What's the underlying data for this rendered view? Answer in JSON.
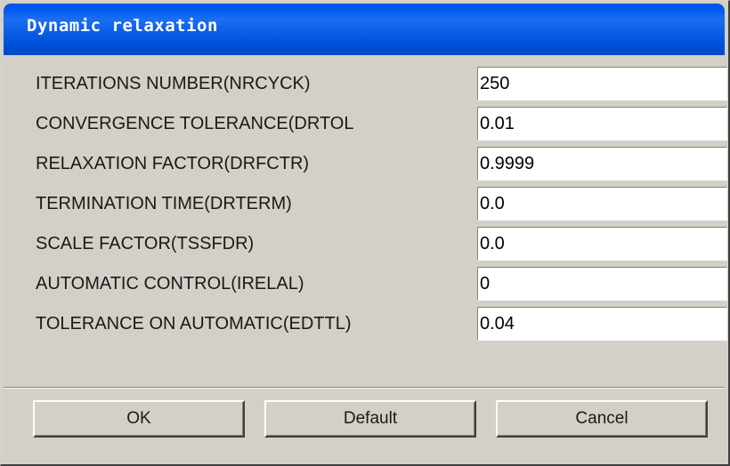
{
  "window": {
    "title": "Dynamic relaxation"
  },
  "fields": [
    {
      "label": "ITERATIONS NUMBER(NRCYCK)",
      "value": "250"
    },
    {
      "label": "CONVERGENCE TOLERANCE(DRTOL",
      "value": "0.01"
    },
    {
      "label": "RELAXATION FACTOR(DRFCTR)",
      "value": "0.9999"
    },
    {
      "label": "TERMINATION TIME(DRTERM)",
      "value": "0.0"
    },
    {
      "label": "SCALE FACTOR(TSSFDR)",
      "value": "0.0"
    },
    {
      "label": "AUTOMATIC CONTROL(IRELAL)",
      "value": "0"
    },
    {
      "label": "TOLERANCE ON AUTOMATIC(EDTTL)",
      "value": "0.04"
    }
  ],
  "buttons": {
    "ok_label": "OK",
    "default_label": "Default",
    "cancel_label": "Cancel"
  },
  "colors": {
    "titlebar": "#0a5ee8",
    "dialog_background": "#d4d0c8",
    "field_background": "#ffffff"
  }
}
